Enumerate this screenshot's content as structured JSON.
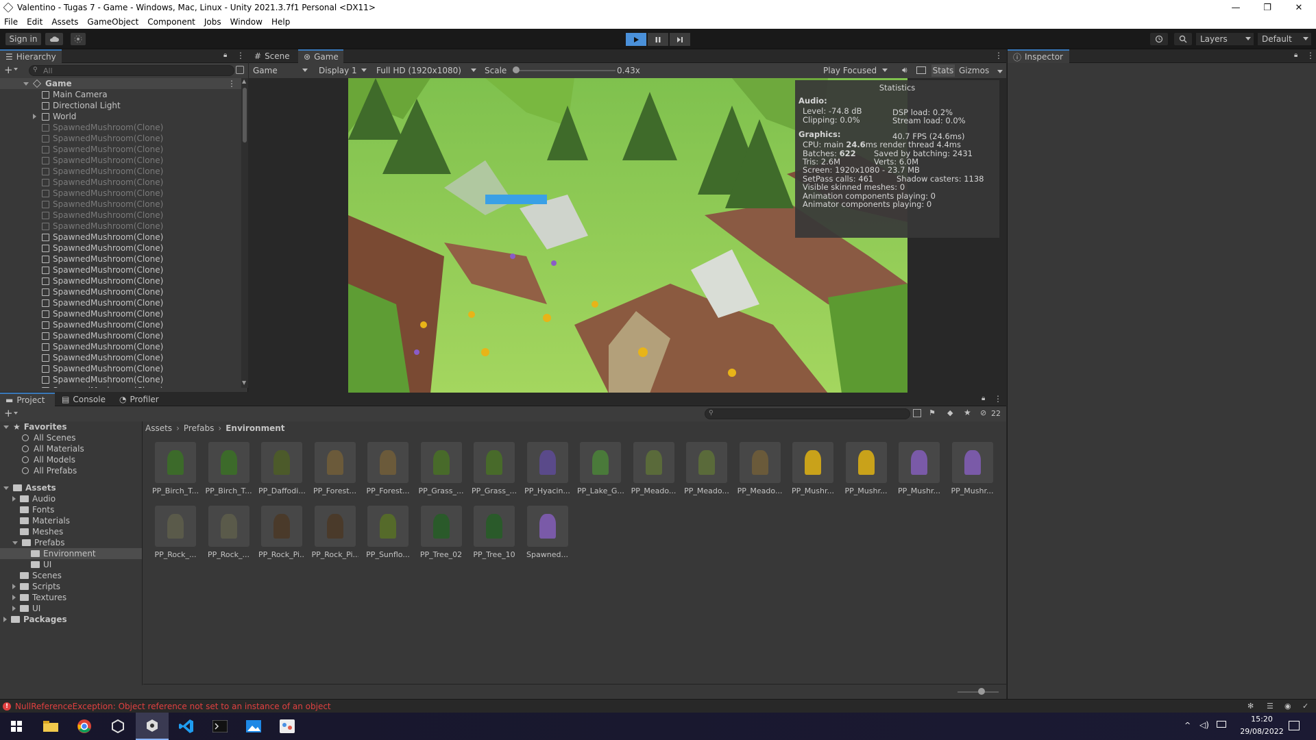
{
  "window": {
    "title": "Valentino - Tugas 7 - Game - Windows, Mac, Linux - Unity 2021.3.7f1 Personal <DX11>",
    "minimize": "—",
    "maximize": "❐",
    "close": "✕"
  },
  "menu": [
    "File",
    "Edit",
    "Assets",
    "GameObject",
    "Component",
    "Jobs",
    "Window",
    "Help"
  ],
  "toolbar": {
    "sign_in": "Sign in",
    "layers": "Layers",
    "layout": "Default"
  },
  "hierarchy": {
    "tab": "Hierarchy",
    "search_placeholder": "All",
    "scene": "Game",
    "items": [
      "Main Camera",
      "Directional Light",
      "World"
    ],
    "spawned_label": "SpawnedMushroom(Clone)",
    "spawned_inactive_count": 10,
    "spawned_active_count": 15
  },
  "scene_view": {
    "tabs": [
      "Scene",
      "Game"
    ],
    "display_mode": "Game",
    "display": "Display 1",
    "resolution": "Full HD (1920x1080)",
    "scale_label": "Scale",
    "scale_value": "0.43x",
    "scale_fraction": 0.03,
    "play_mode": "Play Focused",
    "stats_btn": "Stats",
    "gizmos_btn": "Gizmos"
  },
  "statistics": {
    "title": "Statistics",
    "audio_header": "Audio:",
    "level": "Level: -74.8 dB",
    "clipping": "Clipping: 0.0%",
    "dsp": "DSP load: 0.2%",
    "stream": "Stream load: 0.0%",
    "graphics_header": "Graphics:",
    "fps": "40.7 FPS (24.6ms)",
    "cpu_prefix": "CPU: main ",
    "cpu_main": "24.6",
    "cpu_suffix": "ms  render thread 4.4ms",
    "batches_prefix": "Batches: ",
    "batches": "622",
    "saved_batching": "Saved by batching: 2431",
    "tris": "Tris: 2.6M",
    "verts": "Verts: 6.0M",
    "screen": "Screen: 1920x1080 - 23.7 MB",
    "setpass": "SetPass calls: 461",
    "shadow": "Shadow casters: 1138",
    "skinned": "Visible skinned meshes: 0",
    "anim": "Animation components playing: 0",
    "animator": "Animator components playing: 0"
  },
  "inspector": {
    "tab": "Inspector"
  },
  "project": {
    "tabs": [
      "Project",
      "Console",
      "Profiler"
    ],
    "hidden_count": "22",
    "favorites_header": "Favorites",
    "favorites": [
      "All Scenes",
      "All Materials",
      "All Models",
      "All Prefabs"
    ],
    "assets_header": "Assets",
    "folders": [
      "Audio",
      "Fonts",
      "Materials",
      "Meshes",
      "Prefabs"
    ],
    "prefab_children": [
      "Environment",
      "UI"
    ],
    "folders_after": [
      "Scenes",
      "Scripts",
      "Textures",
      "UI"
    ],
    "packages_header": "Packages",
    "breadcrumb": [
      "Assets",
      "Prefabs",
      "Environment"
    ],
    "assets": [
      "PP_Birch_T...",
      "PP_Birch_T...",
      "PP_Daffodi...",
      "PP_Forest...",
      "PP_Forest...",
      "PP_Grass_...",
      "PP_Grass_...",
      "PP_Hyacin...",
      "PP_Lake_G...",
      "PP_Meado...",
      "PP_Meado...",
      "PP_Meado...",
      "PP_Mushr...",
      "PP_Mushr...",
      "PP_Mushr...",
      "PP_Mushr...",
      "PP_Rock_...",
      "PP_Rock_...",
      "PP_Rock_Pi...",
      "PP_Rock_Pi...",
      "PP_Sunflo...",
      "PP_Tree_02",
      "PP_Tree_10",
      "Spawned..."
    ]
  },
  "status": {
    "error": "NullReferenceException: Object reference not set to an instance of an object"
  },
  "taskbar": {
    "time": "15:20",
    "date": "29/08/2022"
  },
  "colors": {
    "accent": "#3a79bb",
    "error": "#e04040",
    "play_active": "#4a90d9"
  }
}
